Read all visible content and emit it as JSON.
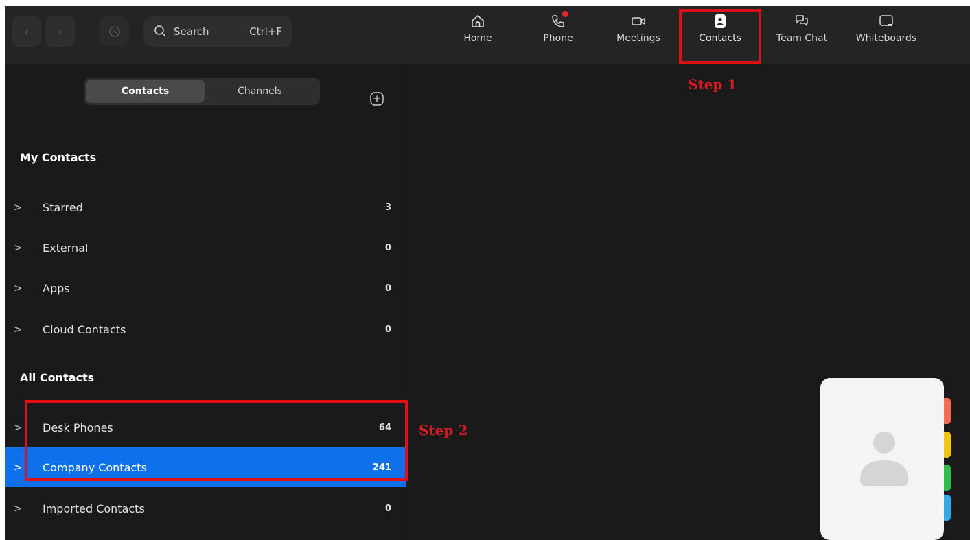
{
  "topbar": {
    "search_label": "Search",
    "search_shortcut": "Ctrl+F",
    "tabs": [
      {
        "label": "Home",
        "icon": "home-icon"
      },
      {
        "label": "Phone",
        "icon": "phone-icon",
        "notification": true
      },
      {
        "label": "Meetings",
        "icon": "video-camera-icon"
      },
      {
        "label": "Contacts",
        "icon": "contact-card-icon",
        "active": true
      },
      {
        "label": "Team Chat",
        "icon": "chat-bubbles-icon"
      },
      {
        "label": "Whiteboards",
        "icon": "whiteboard-icon"
      }
    ]
  },
  "annotations": {
    "step1": "Step 1",
    "step2": "Step 2",
    "highlight_color": "#e00f16"
  },
  "sidebar": {
    "segments": [
      {
        "label": "Contacts",
        "selected": true
      },
      {
        "label": "Channels",
        "selected": false
      }
    ],
    "my_contacts": {
      "heading": "My Contacts",
      "items": [
        {
          "label": "Starred",
          "count": "3"
        },
        {
          "label": "External",
          "count": "0"
        },
        {
          "label": "Apps",
          "count": "0"
        },
        {
          "label": "Cloud Contacts",
          "count": "0"
        }
      ]
    },
    "all_contacts": {
      "heading": "All Contacts",
      "items": [
        {
          "label": "Desk Phones",
          "count": "64"
        },
        {
          "label": "Company Contacts",
          "count": "241",
          "selected": true
        },
        {
          "label": "Imported Contacts",
          "count": "0"
        }
      ]
    }
  },
  "colors": {
    "accent": "#0e71eb",
    "background": "#1a1a1a",
    "topbar": "#242424",
    "notification": "#e5252b"
  }
}
